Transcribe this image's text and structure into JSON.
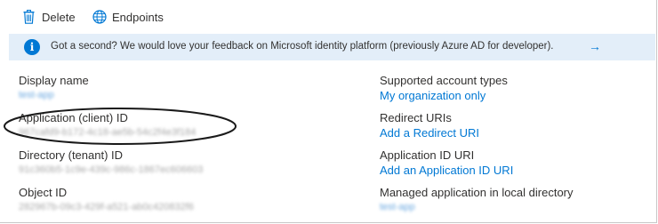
{
  "toolbar": {
    "delete_label": "Delete",
    "endpoints_label": "Endpoints"
  },
  "banner": {
    "message": "Got a second? We would love your feedback on Microsoft identity platform (previously Azure AD for developer).",
    "arrow": "→"
  },
  "left_fields": {
    "display_name": {
      "label": "Display name",
      "value": "test-app"
    },
    "application_id": {
      "label": "Application (client) ID",
      "value": "967cafd9-b172-4c18-ae5b-54c2f4e3f184"
    },
    "directory_id": {
      "label": "Directory (tenant) ID",
      "value": "91c360b5-1c9e-439c-986c-1867ec606603"
    },
    "object_id": {
      "label": "Object ID",
      "value": "282967b-09c3-429f-a521-ab0c420832f6"
    }
  },
  "right_fields": {
    "supported_accounts": {
      "label": "Supported account types",
      "link": "My organization only"
    },
    "redirect_uris": {
      "label": "Redirect URIs",
      "link": "Add a Redirect URI"
    },
    "app_id_uri": {
      "label": "Application ID URI",
      "link": "Add an Application ID URI"
    },
    "managed_app": {
      "label": "Managed application in local directory",
      "value": "test-app"
    }
  },
  "colors": {
    "accent": "#0078d4",
    "banner_bg": "#e3eef9",
    "text": "#323130"
  },
  "icons": {
    "delete": "trash-icon",
    "endpoints": "globe-icon",
    "info": "info-icon",
    "arrow": "arrow-right-icon"
  }
}
